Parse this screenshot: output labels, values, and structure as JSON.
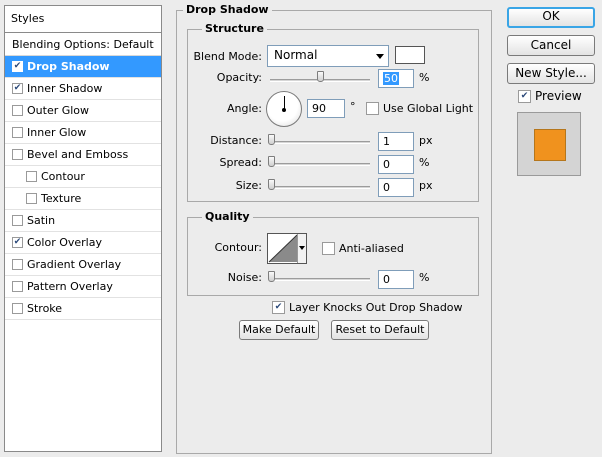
{
  "styles_panel": {
    "header": "Styles",
    "items": [
      {
        "label": "Blending Options: Default",
        "checkbox": false,
        "checked": false,
        "selected": false,
        "indent": false
      },
      {
        "label": "Drop Shadow",
        "checkbox": true,
        "checked": true,
        "selected": true,
        "indent": false
      },
      {
        "label": "Inner Shadow",
        "checkbox": true,
        "checked": true,
        "selected": false,
        "indent": false
      },
      {
        "label": "Outer Glow",
        "checkbox": true,
        "checked": false,
        "selected": false,
        "indent": false
      },
      {
        "label": "Inner Glow",
        "checkbox": true,
        "checked": false,
        "selected": false,
        "indent": false
      },
      {
        "label": "Bevel and Emboss",
        "checkbox": true,
        "checked": false,
        "selected": false,
        "indent": false
      },
      {
        "label": "Contour",
        "checkbox": true,
        "checked": false,
        "selected": false,
        "indent": true
      },
      {
        "label": "Texture",
        "checkbox": true,
        "checked": false,
        "selected": false,
        "indent": true
      },
      {
        "label": "Satin",
        "checkbox": true,
        "checked": false,
        "selected": false,
        "indent": false
      },
      {
        "label": "Color Overlay",
        "checkbox": true,
        "checked": true,
        "selected": false,
        "indent": false
      },
      {
        "label": "Gradient Overlay",
        "checkbox": true,
        "checked": false,
        "selected": false,
        "indent": false
      },
      {
        "label": "Pattern Overlay",
        "checkbox": true,
        "checked": false,
        "selected": false,
        "indent": false
      },
      {
        "label": "Stroke",
        "checkbox": true,
        "checked": false,
        "selected": false,
        "indent": false
      }
    ]
  },
  "drop_shadow": {
    "title": "Drop Shadow",
    "structure": {
      "title": "Structure",
      "blend_mode_label": "Blend Mode:",
      "blend_mode_value": "Normal",
      "shadow_color": "#ffffff",
      "opacity_label": "Opacity:",
      "opacity_value": "50",
      "opacity_level": 0.5,
      "opacity_unit": "%",
      "angle_label": "Angle:",
      "angle_value": "90",
      "angle_unit": "°",
      "global_light_label": "Use Global Light",
      "global_light_checked": false,
      "distance_label": "Distance:",
      "distance_value": "1",
      "distance_unit": "px",
      "spread_label": "Spread:",
      "spread_value": "0",
      "spread_unit": "%",
      "size_label": "Size:",
      "size_value": "0",
      "size_unit": "px"
    },
    "quality": {
      "title": "Quality",
      "contour_label": "Contour:",
      "anti_aliased_label": "Anti-aliased",
      "anti_aliased_checked": false,
      "noise_label": "Noise:",
      "noise_value": "0",
      "noise_unit": "%"
    },
    "knocks_out_label": "Layer Knocks Out Drop Shadow",
    "knocks_out_checked": true,
    "make_default_label": "Make Default",
    "reset_default_label": "Reset to Default"
  },
  "right_panel": {
    "ok_label": "OK",
    "cancel_label": "Cancel",
    "new_style_label": "New Style...",
    "preview_label": "Preview",
    "preview_checked": true,
    "preview_color": "#f0921e"
  },
  "colors": {
    "selection": "#3399ff",
    "accent_border": "#39a5e6"
  }
}
